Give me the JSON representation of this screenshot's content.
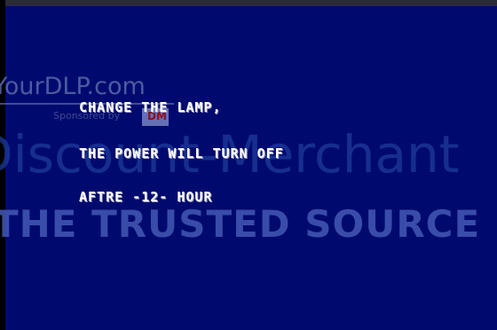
{
  "osd": {
    "line1": "CHANGE THE LAMP,",
    "line2": "THE POWER WILL TURN OFF",
    "line3": "AFTRE -12- HOUR"
  },
  "watermark": {
    "site": "YourDLP.com",
    "sponsored": "Sponsored by",
    "badge": "DM",
    "merchant": "Discount-Merchant",
    "tagline": "THE TRUSTED SOURCE FOR PRO"
  },
  "colors": {
    "background": "#000a6e",
    "osd_text": "#ffffff",
    "watermark": "#4458b4"
  }
}
